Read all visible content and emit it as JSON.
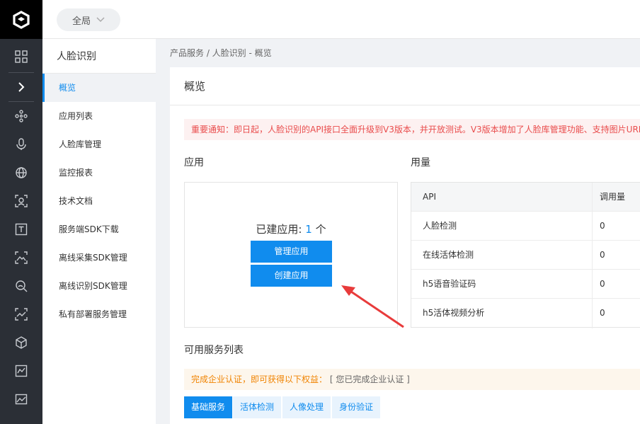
{
  "rail": {
    "icons": [
      "apps-grid-icon",
      "chevron-right-icon",
      "network-icon",
      "microphone-icon",
      "globe-icon",
      "face-scan-icon",
      "text-recognition-icon",
      "image-scan-icon",
      "face-search-icon",
      "image-analysis-icon",
      "cube-icon",
      "chart-icon",
      "image-icon"
    ]
  },
  "topbar": {
    "scope_label": "全局"
  },
  "subnav": {
    "title": "人脸识别",
    "items": [
      {
        "label": "概览",
        "active": true
      },
      {
        "label": "应用列表"
      },
      {
        "label": "人脸库管理"
      },
      {
        "label": "监控报表"
      },
      {
        "label": "技术文档"
      },
      {
        "label": "服务端SDK下载"
      },
      {
        "label": "离线采集SDK管理"
      },
      {
        "label": "离线识别SDK管理"
      },
      {
        "label": "私有部署服务管理"
      }
    ]
  },
  "breadcrumb": "产品服务 / 人脸识别 - 概览",
  "panel": {
    "title": "概览",
    "notice": "重要通知：即日起，人脸识别的API接口全面升级到V3版本，并开放测试。V3版本增加了人脸库管理功能、支持图片URL"
  },
  "apps": {
    "section_label": "应用",
    "count_label": "已建应用:",
    "count_value": "1",
    "count_unit": "个",
    "manage_button": "管理应用",
    "create_button": "创建应用"
  },
  "usage": {
    "section_label": "用量",
    "columns": [
      "API",
      "调用量"
    ],
    "rows": [
      {
        "api": "人脸检测",
        "calls": "0"
      },
      {
        "api": "在线活体检测",
        "calls": "0"
      },
      {
        "api": "h5语音验证码",
        "calls": "0"
      },
      {
        "api": "h5活体视频分析",
        "calls": "0"
      }
    ]
  },
  "services": {
    "section_label": "可用服务列表",
    "enterprise_text": "完成企业认证，即可获得以下权益：",
    "enterprise_status": "[ 您已完成企业认证 ]",
    "tabs": [
      {
        "label": "基础服务",
        "active": true
      },
      {
        "label": "活体检测"
      },
      {
        "label": "人像处理"
      },
      {
        "label": "身份验证"
      }
    ]
  },
  "colors": {
    "accent": "#108cee",
    "rail": "#2b2f36",
    "notice": "#e94c4c",
    "warning": "#f08300"
  }
}
